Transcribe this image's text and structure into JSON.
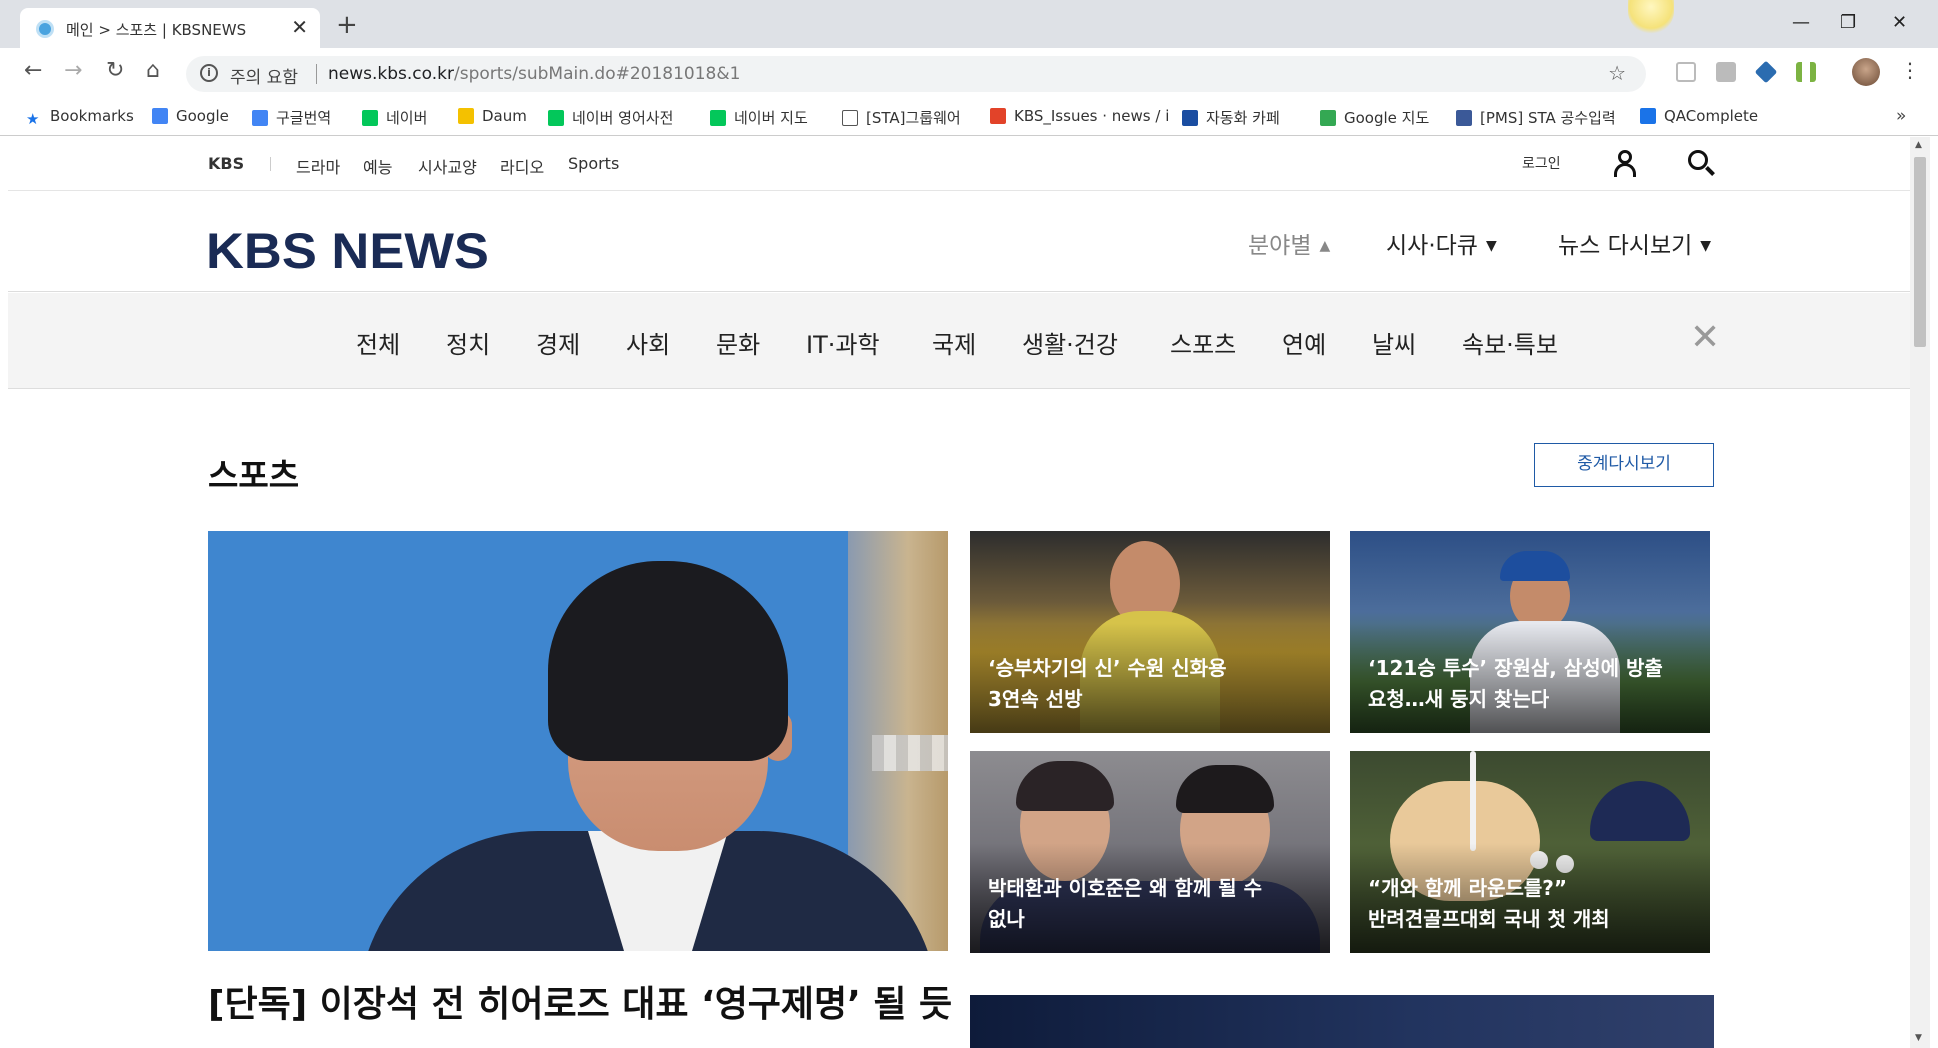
{
  "browser": {
    "tab_title": "메인 > 스포츠 | KBSNEWS",
    "close_glyph": "✕",
    "new_tab_glyph": "+",
    "security_label": "주의 요함",
    "url_host": "news.kbs.co.kr",
    "url_path": "/sports/subMain.do#20181018&1",
    "bookmarks": [
      {
        "label": "Bookmarks",
        "icon": "star-icon",
        "color": "#1a73e8"
      },
      {
        "label": "Google",
        "icon": "google-icon",
        "color": "#4285f4"
      },
      {
        "label": "구글번역",
        "icon": "translate-icon",
        "color": "#4285f4"
      },
      {
        "label": "네이버",
        "icon": "naver-icon",
        "color": "#03c75a"
      },
      {
        "label": "Daum",
        "icon": "daum-icon",
        "color": "#f4c100"
      },
      {
        "label": "네이버 영어사전",
        "icon": "naver-dict-icon",
        "color": "#03c75a"
      },
      {
        "label": "네이버 지도",
        "icon": "naver-map-icon",
        "color": "#03c75a"
      },
      {
        "label": "[STA]그룹웨어",
        "icon": "page-icon",
        "color": "#ffffff"
      },
      {
        "label": "KBS_Issues · news / i",
        "icon": "gitlab-icon",
        "color": "#e24329"
      },
      {
        "label": "자동화 카페",
        "icon": "stpg-icon",
        "color": "#1a4da1"
      },
      {
        "label": "Google 지도",
        "icon": "maps-icon",
        "color": "#34a853"
      },
      {
        "label": "[PMS] STA 공수입력",
        "icon": "pms-icon",
        "color": "#3b5998"
      },
      {
        "label": "QAComplete",
        "icon": "qacomplete-icon",
        "color": "#1a73e8"
      }
    ],
    "more_glyph": "»"
  },
  "gnb": {
    "brand": "KBS",
    "items": [
      "드라마",
      "예능",
      "시사교양",
      "라디오",
      "Sports"
    ],
    "login": "로그인"
  },
  "header": {
    "logo": "KBS NEWS",
    "menus": [
      {
        "label": "분야별",
        "caret": "▲"
      },
      {
        "label": "시사·다큐",
        "caret": "▼"
      },
      {
        "label": "뉴스 다시보기",
        "caret": "▼"
      }
    ]
  },
  "categories": [
    "전체",
    "정치",
    "경제",
    "사회",
    "문화",
    "IT·과학",
    "국제",
    "생활·건강",
    "스포츠",
    "연예",
    "날씨",
    "속보·특보"
  ],
  "category_close": "✕",
  "section": {
    "title": "스포츠",
    "replay_button": "중계다시보기"
  },
  "cards": [
    {
      "line1": "‘승부차기의 신’ 수원 신화용",
      "line2": "3연속 선방"
    },
    {
      "line1": "‘121승 투수’ 장원삼, 삼성에 방출",
      "line2": "요청…새 둥지 찾는다"
    },
    {
      "line1": "박태환과 이호준은 왜 함께 될 수",
      "line2": "없나"
    },
    {
      "line1": "“개와 함께 라운드를?”",
      "line2": "반려견골프대회 국내 첫 개최"
    }
  ],
  "hero": {
    "title": "[단독] 이장석 전 히어로즈 대표 ‘영구제명’ 될 듯"
  }
}
